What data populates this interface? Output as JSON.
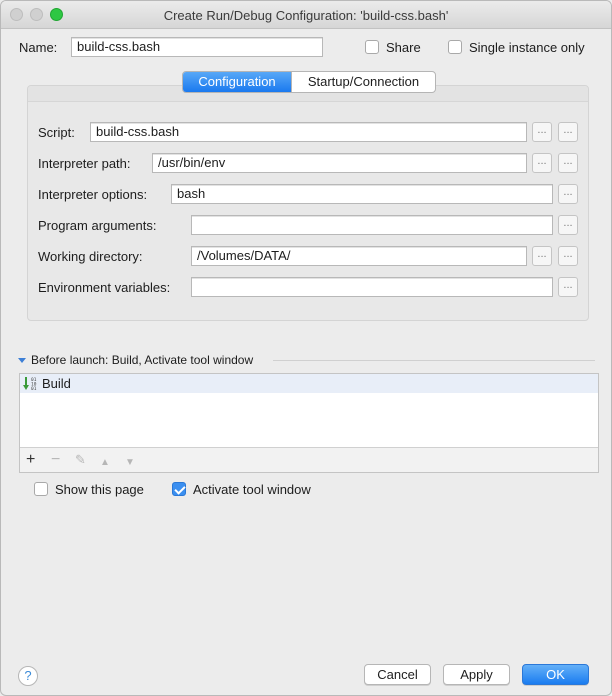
{
  "window": {
    "title": "Create Run/Debug Configuration: 'build-css.bash'"
  },
  "header": {
    "name_label": "Name:",
    "name_value": "build-css.bash",
    "share_label": "Share",
    "share_checked": false,
    "single_instance_label": "Single instance only",
    "single_instance_checked": false
  },
  "tabs": [
    {
      "label": "Configuration",
      "active": true
    },
    {
      "label": "Startup/Connection",
      "active": false
    }
  ],
  "form": {
    "script_label": "Script:",
    "script_value": "build-css.bash",
    "interpreter_path_label": "Interpreter path:",
    "interpreter_path_value": "/usr/bin/env",
    "interpreter_options_label": "Interpreter options:",
    "interpreter_options_value": "bash",
    "program_arguments_label": "Program arguments:",
    "program_arguments_value": "",
    "working_directory_label": "Working directory:",
    "working_directory_value": "/Volumes/DATA/",
    "environment_variables_label": "Environment variables:",
    "environment_variables_value": "",
    "browse_glyph": "..."
  },
  "before_launch": {
    "title": "Before launch: Build, Activate tool window",
    "items": [
      {
        "label": "Build",
        "icon": "build-binary-icon"
      }
    ],
    "toolbar": {
      "add": "+",
      "remove": "−",
      "edit": "✎",
      "up": "▲",
      "down": "▼"
    }
  },
  "options": {
    "show_page_label": "Show this page",
    "show_page_checked": false,
    "activate_tool_window_label": "Activate tool window",
    "activate_tool_window_checked": true
  },
  "footer": {
    "help_glyph": "?",
    "cancel_label": "Cancel",
    "apply_label": "Apply",
    "ok_label": "OK"
  },
  "colors": {
    "accent": "#1a7cf0",
    "window_bg": "#ececec"
  }
}
